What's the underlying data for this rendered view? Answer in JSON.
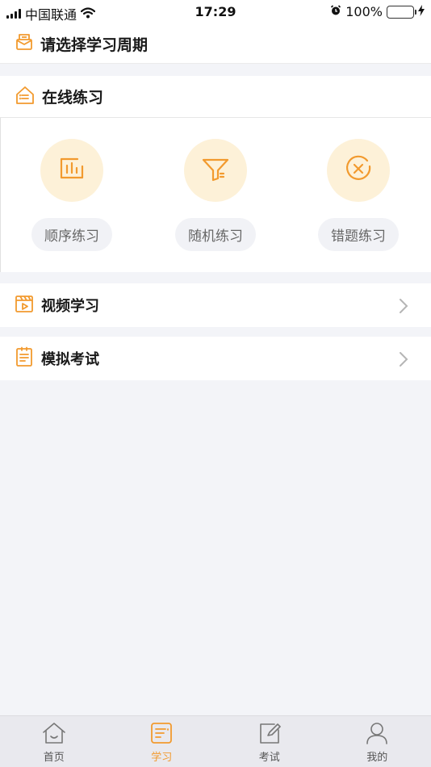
{
  "status_bar": {
    "carrier": "中国联通",
    "time": "17:29",
    "battery": "100%"
  },
  "period_selector": {
    "label": "请选择学习周期",
    "icon": "study-period-icon"
  },
  "online_practice": {
    "title": "在线练习",
    "icon": "home-list-icon",
    "items": [
      {
        "label": "顺序练习",
        "icon": "sequence-chart-icon"
      },
      {
        "label": "随机练习",
        "icon": "filter-funnel-icon"
      },
      {
        "label": "错题练习",
        "icon": "wrong-x-circle-icon"
      }
    ]
  },
  "video_study": {
    "label": "视频学习",
    "icon": "video-clapper-icon"
  },
  "mock_exam": {
    "label": "模拟考试",
    "icon": "clipboard-list-icon"
  },
  "tab_bar": {
    "tabs": [
      {
        "label": "首页",
        "icon": "home-icon",
        "active": false
      },
      {
        "label": "学习",
        "icon": "study-icon",
        "active": true
      },
      {
        "label": "考试",
        "icon": "exam-edit-icon",
        "active": false
      },
      {
        "label": "我的",
        "icon": "profile-icon",
        "active": false
      }
    ]
  },
  "colors": {
    "accent": "#f29a2e",
    "icon_circle_bg": "#fdf1d8",
    "background": "#f3f4f8",
    "pill_bg": "#f1f2f6"
  }
}
